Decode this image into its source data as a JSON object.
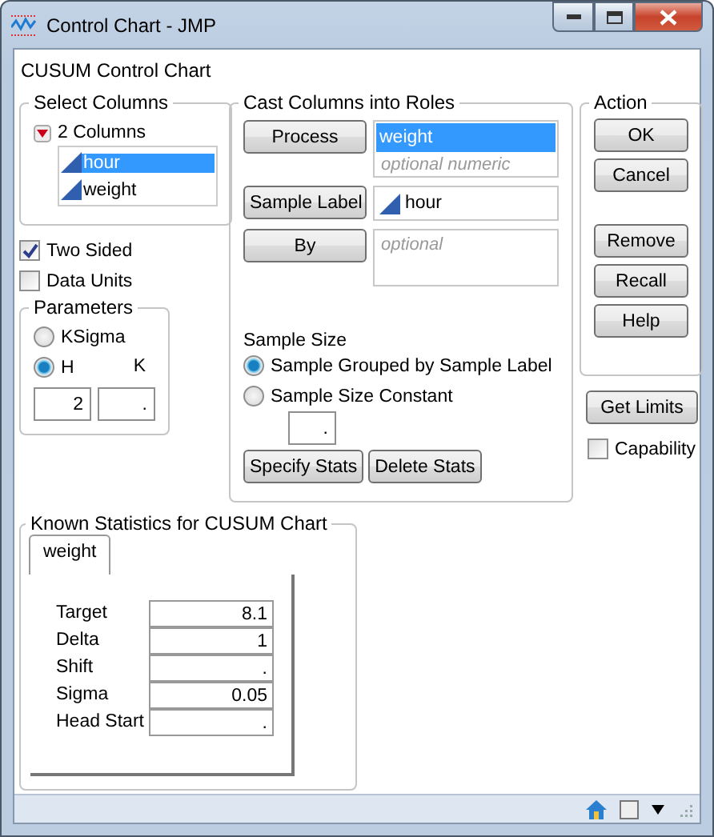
{
  "window": {
    "title": "Control Chart - JMP"
  },
  "heading": "CUSUM Control Chart",
  "select_columns": {
    "title": "Select Columns",
    "count": "2 Columns",
    "columns": [
      {
        "name": "hour",
        "selected": true
      },
      {
        "name": "weight",
        "selected": false
      }
    ]
  },
  "options": [
    {
      "label": "Two Sided",
      "checked": true
    },
    {
      "label": "Data Units",
      "checked": false
    }
  ],
  "parameters": {
    "title": "Parameters",
    "radios": [
      {
        "label": "KSigma",
        "selected": false
      },
      {
        "label": "H",
        "selected": true
      }
    ],
    "k_label": "K",
    "h_value": "2",
    "k_value": "."
  },
  "roles": {
    "title": "Cast Columns into Roles",
    "items": [
      {
        "button": "Process",
        "values": [
          {
            "text": "weight",
            "selected": true
          }
        ],
        "placeholder": "optional numeric"
      },
      {
        "button": "Sample Label",
        "values": [
          {
            "text": "hour",
            "selected": false
          }
        ]
      },
      {
        "button": "By",
        "placeholder": "optional"
      }
    ]
  },
  "sample_size": {
    "title": "Sample Size",
    "options": [
      {
        "label": "Sample Grouped by Sample Label",
        "selected": true
      },
      {
        "label": "Sample Size Constant",
        "selected": false
      }
    ],
    "constant_value": "."
  },
  "stat_buttons": [
    "Specify Stats",
    "Delete Stats"
  ],
  "action": {
    "title": "Action",
    "groups": [
      [
        "OK",
        "Cancel"
      ],
      [
        "Remove",
        "Recall",
        "Help"
      ]
    ]
  },
  "get_limits": "Get Limits",
  "capability": {
    "label": "Capability",
    "checked": false
  },
  "known_statistics": {
    "title": "Known Statistics for CUSUM Chart",
    "tabs": [
      {
        "label": "weight",
        "selected": true
      }
    ],
    "rows": [
      {
        "label": "Target",
        "value": "8.1"
      },
      {
        "label": "Delta",
        "value": "1"
      },
      {
        "label": "Shift",
        "value": "."
      },
      {
        "label": "Sigma",
        "value": "0.05"
      },
      {
        "label": "Head Start",
        "value": "."
      }
    ]
  }
}
